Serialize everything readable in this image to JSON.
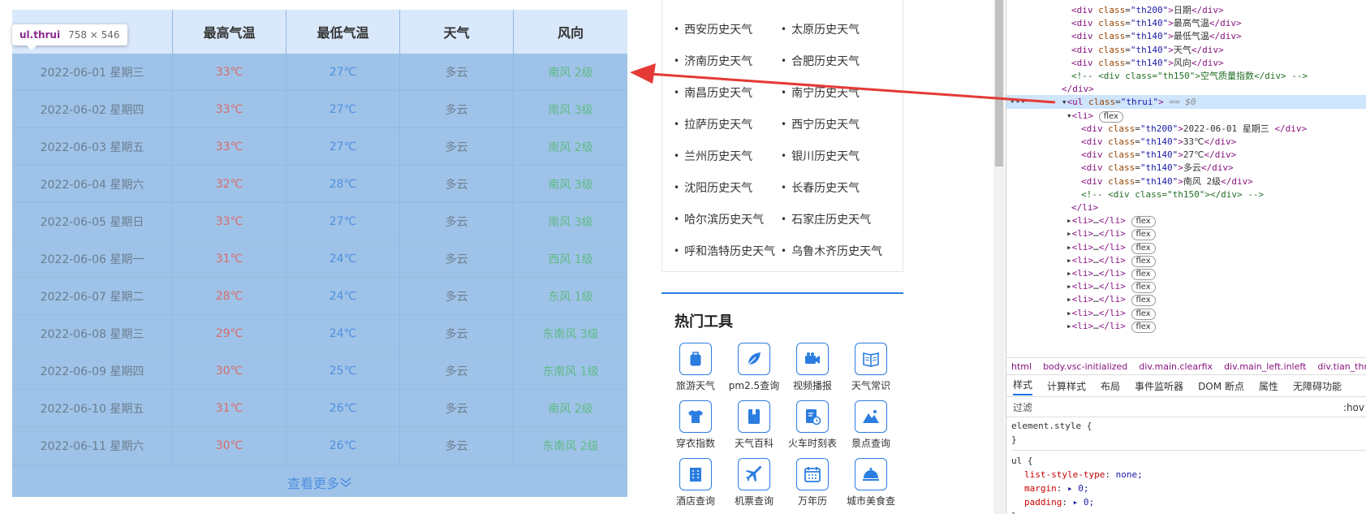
{
  "inspect_tag": {
    "selector": "ul.thrui",
    "size": "758 × 546"
  },
  "table": {
    "headers": [
      "最高气温",
      "最低气温",
      "天气",
      "风向"
    ],
    "rows": [
      {
        "date": "2022-06-01 星期三",
        "high": "33℃",
        "low": "27℃",
        "weather": "多云",
        "wind": "南风 2级"
      },
      {
        "date": "2022-06-02 星期四",
        "high": "33℃",
        "low": "27℃",
        "weather": "多云",
        "wind": "南风 3级"
      },
      {
        "date": "2022-06-03 星期五",
        "high": "33℃",
        "low": "27℃",
        "weather": "多云",
        "wind": "南风 2级"
      },
      {
        "date": "2022-06-04 星期六",
        "high": "32℃",
        "low": "28℃",
        "weather": "多云",
        "wind": "南风 3级"
      },
      {
        "date": "2022-06-05 星期日",
        "high": "33℃",
        "low": "27℃",
        "weather": "多云",
        "wind": "南风 3级"
      },
      {
        "date": "2022-06-06 星期一",
        "high": "31℃",
        "low": "24℃",
        "weather": "多云",
        "wind": "西风 1级"
      },
      {
        "date": "2022-06-07 星期二",
        "high": "28℃",
        "low": "24℃",
        "weather": "多云",
        "wind": "东风 1级"
      },
      {
        "date": "2022-06-08 星期三",
        "high": "29℃",
        "low": "24℃",
        "weather": "多云",
        "wind": "东南风 3级"
      },
      {
        "date": "2022-06-09 星期四",
        "high": "30℃",
        "low": "25℃",
        "weather": "多云",
        "wind": "东南风 1级"
      },
      {
        "date": "2022-06-10 星期五",
        "high": "31℃",
        "low": "26℃",
        "weather": "多云",
        "wind": "南风 2级"
      },
      {
        "date": "2022-06-11 星期六",
        "high": "30℃",
        "low": "26℃",
        "weather": "多云",
        "wind": "东南风 2级"
      }
    ],
    "more_label": "查看更多"
  },
  "cities": [
    "西安历史天气",
    "太原历史天气",
    "济南历史天气",
    "合肥历史天气",
    "南昌历史天气",
    "南宁历史天气",
    "拉萨历史天气",
    "西宁历史天气",
    "兰州历史天气",
    "银川历史天气",
    "沈阳历史天气",
    "长春历史天气",
    "哈尔滨历史天气",
    "石家庄历史天气",
    "呼和浩特历史天气",
    "乌鲁木齐历史天气"
  ],
  "tools": {
    "title": "热门工具",
    "items": [
      {
        "label": "旅游天气",
        "icon": "luggage-icon"
      },
      {
        "label": "pm2.5查询",
        "icon": "leaf-icon"
      },
      {
        "label": "视频播报",
        "icon": "video-camera-icon"
      },
      {
        "label": "天气常识",
        "icon": "book-icon"
      },
      {
        "label": "穿衣指数",
        "icon": "tshirt-icon"
      },
      {
        "label": "天气百科",
        "icon": "bookmark-book-icon"
      },
      {
        "label": "火车时刻表",
        "icon": "schedule-icon"
      },
      {
        "label": "景点查询",
        "icon": "mountain-icon"
      },
      {
        "label": "酒店查询",
        "icon": "building-icon"
      },
      {
        "label": "机票查询",
        "icon": "airplane-icon"
      },
      {
        "label": "万年历",
        "icon": "calendar-icon"
      },
      {
        "label": "城市美食查",
        "icon": "food-cloche-icon"
      }
    ]
  },
  "devtools": {
    "breadcrumbs": [
      "html",
      "body.vsc-initialized",
      "div.main.clearfix",
      "div.main_left.inleft",
      "div.tian_three"
    ],
    "tabs": [
      "样式",
      "计算样式",
      "布局",
      "事件监听器",
      "DOM 断点",
      "属性",
      "无障碍功能"
    ],
    "filter_placeholder": "过滤",
    "filter_hov": ":hov",
    "flex_badge": "flex",
    "selected_eq": "== $0",
    "header_divs": [
      {
        "cls": "th200",
        "text": "日期"
      },
      {
        "cls": "th140",
        "text": "最高气温"
      },
      {
        "cls": "th140",
        "text": "最低气温"
      },
      {
        "cls": "th140",
        "text": "天气"
      },
      {
        "cls": "th140",
        "text": "风向"
      }
    ],
    "comment_header": "<!-- <div class=\"th150\">空气质量指数</div> -->",
    "first_li_divs": [
      {
        "cls": "th200",
        "text": "2022-06-01 星期三 "
      },
      {
        "cls": "th140",
        "text": "33℃"
      },
      {
        "cls": "th140",
        "text": "27℃"
      },
      {
        "cls": "th140",
        "text": "多云"
      },
      {
        "cls": "th140",
        "text": "南风 2级"
      }
    ],
    "comment_li": "<!-- <div class=\"th150\"></div> -->",
    "collapsed_li_count": 9,
    "styles": {
      "element_style": "element.style {",
      "ul_selector": "ul {",
      "props": [
        {
          "name": "list-style-type",
          "value": "none;"
        },
        {
          "name": "margin",
          "value": "▸ 0;"
        },
        {
          "name": "padding",
          "value": "▸ 0;"
        }
      ]
    }
  },
  "colors": {
    "header_bg": "#d9e8fb",
    "overlay_bg": "#9fc3e8",
    "accent": "#2b7de0",
    "arrow": "#e53935"
  }
}
